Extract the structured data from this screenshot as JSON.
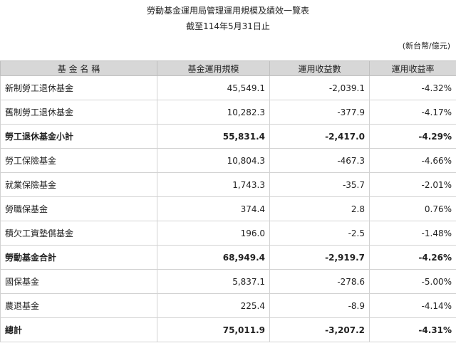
{
  "header": {
    "title": "勞動基金運用局管理運用規模及績效一覽表",
    "subtitle": "截至114年5月31日止",
    "unit": "(新台幣/億元)"
  },
  "table": {
    "columns": [
      "基 金 名 稱",
      "基金運用規模",
      "運用收益數",
      "運用收益率"
    ],
    "rows": [
      {
        "name": "新制勞工退休基金",
        "scale": "45,549.1",
        "income": "-2,039.1",
        "rate": "-4.32%",
        "subtotal": false
      },
      {
        "name": "舊制勞工退休基金",
        "scale": "10,282.3",
        "income": "-377.9",
        "rate": "-4.17%",
        "subtotal": false
      },
      {
        "name": "勞工退休基金小計",
        "scale": "55,831.4",
        "income": "-2,417.0",
        "rate": "-4.29%",
        "subtotal": true
      },
      {
        "name": "勞工保險基金",
        "scale": "10,804.3",
        "income": "-467.3",
        "rate": "-4.66%",
        "subtotal": false
      },
      {
        "name": "就業保險基金",
        "scale": "1,743.3",
        "income": "-35.7",
        "rate": "-2.01%",
        "subtotal": false
      },
      {
        "name": "勞職保基金",
        "scale": "374.4",
        "income": "2.8",
        "rate": "0.76%",
        "subtotal": false
      },
      {
        "name": "積欠工資墊償基金",
        "scale": "196.0",
        "income": "-2.5",
        "rate": "-1.48%",
        "subtotal": false
      },
      {
        "name": "勞動基金合計",
        "scale": "68,949.4",
        "income": "-2,919.7",
        "rate": "-4.26%",
        "subtotal": true
      },
      {
        "name": "國保基金",
        "scale": "5,837.1",
        "income": "-278.6",
        "rate": "-5.00%",
        "subtotal": false
      },
      {
        "name": "農退基金",
        "scale": "225.4",
        "income": "-8.9",
        "rate": "-4.14%",
        "subtotal": false
      },
      {
        "name": "總計",
        "scale": "75,011.9",
        "income": "-3,207.2",
        "rate": "-4.31%",
        "subtotal": true
      }
    ]
  }
}
